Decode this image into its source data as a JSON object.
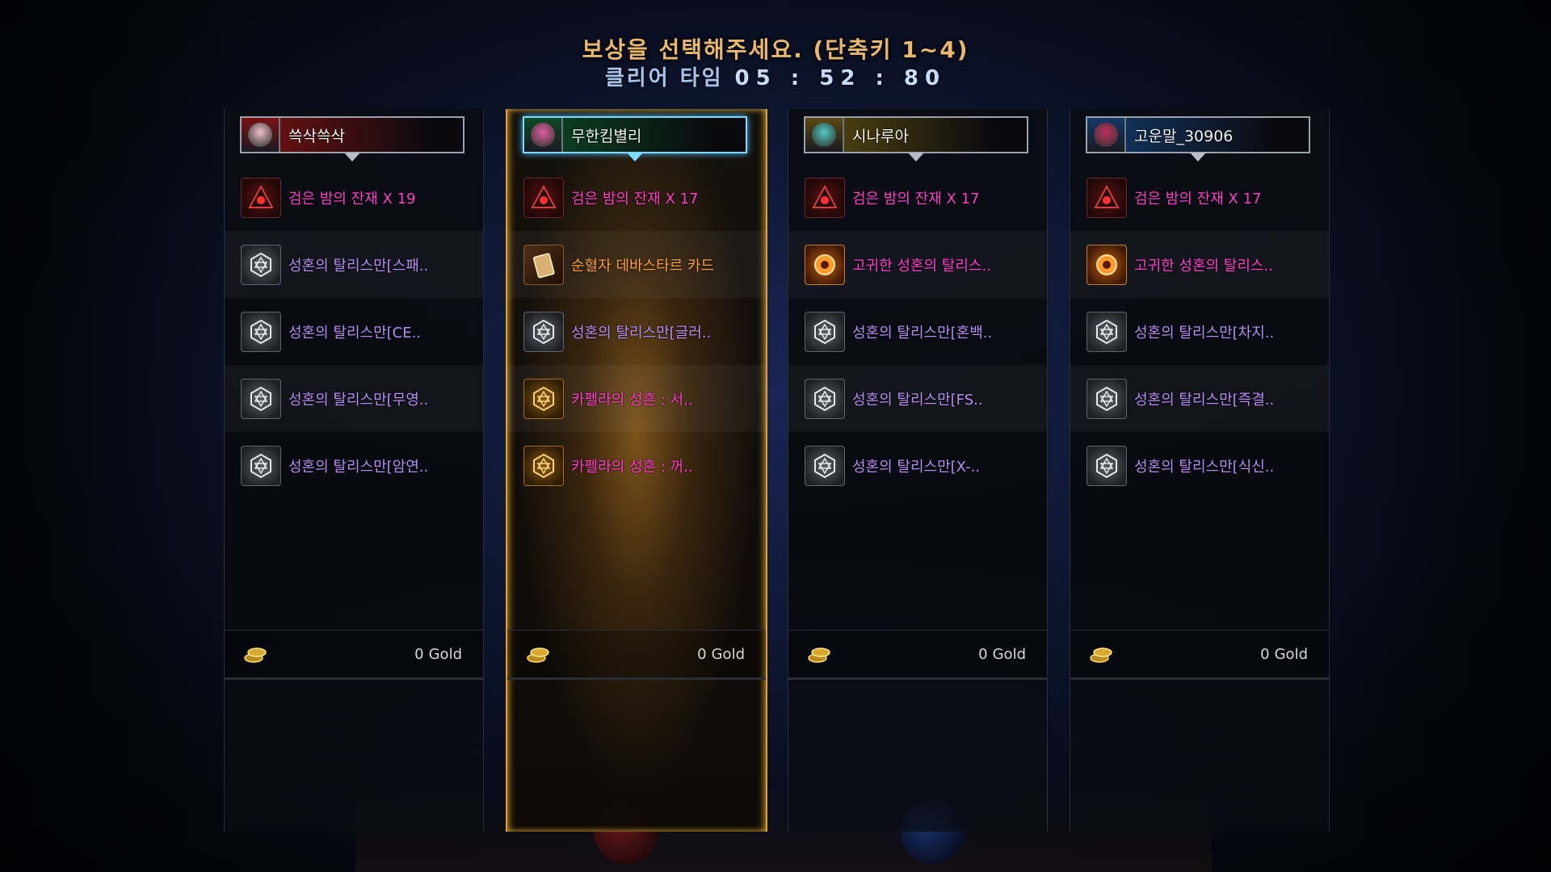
{
  "title": "보상을 선택해주세요. (단축키 1~4)",
  "clear_time": {
    "label": "클리어 타임",
    "value": "05 : 52 : 80"
  },
  "gold_unit": "Gold",
  "players": [
    {
      "name": "쓱삭쓱삭",
      "plate_color": "#7a1212",
      "avatar_color": "#f0c0c8",
      "selected": false,
      "items": [
        {
          "name": "검은 밤의 잔재 X 19",
          "color": "pink",
          "icon": "dark-remnant-icon"
        },
        {
          "name": "성혼의 탈리스만[스패..",
          "color": "purple",
          "icon": "hexagram-talisman-icon"
        },
        {
          "name": "성혼의 탈리스만[CE..",
          "color": "purple",
          "icon": "hexagram-talisman-icon"
        },
        {
          "name": "성혼의 탈리스만[무영..",
          "color": "purple",
          "icon": "hexagram-talisman-icon"
        },
        {
          "name": "성혼의 탈리스만[암연..",
          "color": "purple",
          "icon": "hexagram-talisman-icon"
        }
      ],
      "gold": "0"
    },
    {
      "name": "무한킴별리",
      "plate_color": "#0c4a24",
      "avatar_color": "#e060a0",
      "selected": true,
      "items": [
        {
          "name": "검은 밤의 잔재 X 17",
          "color": "pink",
          "icon": "dark-remnant-icon"
        },
        {
          "name": "순혈자 데바스타르 카드",
          "color": "orange",
          "icon": "card-icon"
        },
        {
          "name": "성혼의 탈리스만[글러..",
          "color": "purple",
          "icon": "hexagram-talisman-icon"
        },
        {
          "name": "카펠라의 성흔 : 서..",
          "color": "pink",
          "icon": "capella-stigma-icon"
        },
        {
          "name": "카펠라의 성흔 : 꺼..",
          "color": "pink",
          "icon": "capella-stigma-icon"
        }
      ],
      "gold": "0"
    },
    {
      "name": "시나루아",
      "plate_color": "#5a4a10",
      "avatar_color": "#50c8c0",
      "selected": false,
      "items": [
        {
          "name": "검은 밤의 잔재 X 17",
          "color": "pink",
          "icon": "dark-remnant-icon"
        },
        {
          "name": "고귀한 성혼의 탈리스..",
          "color": "pink",
          "icon": "noble-talisman-icon"
        },
        {
          "name": "성혼의 탈리스만[혼백..",
          "color": "purple",
          "icon": "hexagram-talisman-icon"
        },
        {
          "name": "성혼의 탈리스만[FS..",
          "color": "purple",
          "icon": "hexagram-talisman-icon"
        },
        {
          "name": "성혼의 탈리스만[X-..",
          "color": "purple",
          "icon": "hexagram-talisman-icon"
        }
      ],
      "gold": "0"
    },
    {
      "name": "고운말_30906",
      "plate_color": "#143a6a",
      "avatar_color": "#c03060",
      "selected": false,
      "items": [
        {
          "name": "검은 밤의 잔재 X 17",
          "color": "pink",
          "icon": "dark-remnant-icon"
        },
        {
          "name": "고귀한 성혼의 탈리스..",
          "color": "pink",
          "icon": "noble-talisman-icon"
        },
        {
          "name": "성혼의 탈리스만[차지..",
          "color": "purple",
          "icon": "hexagram-talisman-icon"
        },
        {
          "name": "성혼의 탈리스만[즉결..",
          "color": "purple",
          "icon": "hexagram-talisman-icon"
        },
        {
          "name": "성혼의 탈리스만[식신..",
          "color": "purple",
          "icon": "hexagram-talisman-icon"
        }
      ],
      "gold": "0"
    }
  ]
}
